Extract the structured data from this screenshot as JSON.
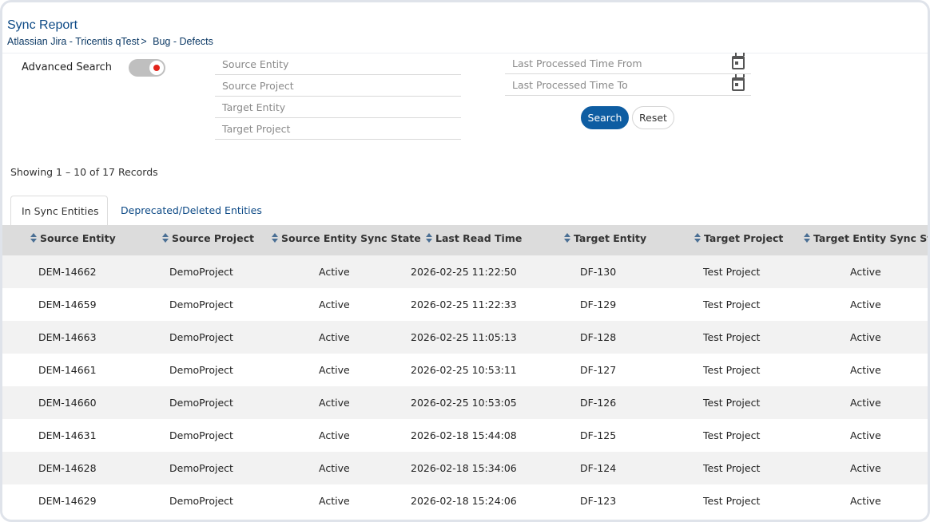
{
  "header": {
    "title": "Sync Report",
    "breadcrumb": [
      "Atlassian Jira - Tricentis qTest",
      "Bug - Defects"
    ],
    "breadcrumb_separator": ">"
  },
  "search": {
    "advanced_label": "Advanced Search",
    "advanced_enabled": true,
    "fields": {
      "source_entity": "Source Entity",
      "source_project": "Source Project",
      "target_entity": "Target Entity",
      "target_project": "Target Project",
      "last_processed_from": "Last Processed Time From",
      "last_processed_to": "Last Processed Time To"
    },
    "search_label": "Search",
    "reset_label": "Reset"
  },
  "records_text": "Showing 1 – 10 of 17 Records",
  "tabs": [
    {
      "label": "In Sync Entities",
      "active": true
    },
    {
      "label": "Deprecated/Deleted Entities",
      "active": false
    }
  ],
  "table": {
    "columns": [
      "Source Entity",
      "Source Project",
      "Source Entity Sync State",
      "Last Read Time",
      "Target Entity",
      "Target Project",
      "Target Entity Sync State"
    ],
    "rows": [
      [
        "DEM-14662",
        "DemoProject",
        "Active",
        "2026-02-25 11:22:50",
        "DF-130",
        "Test Project",
        "Active"
      ],
      [
        "DEM-14659",
        "DemoProject",
        "Active",
        "2026-02-25 11:22:33",
        "DF-129",
        "Test Project",
        "Active"
      ],
      [
        "DEM-14663",
        "DemoProject",
        "Active",
        "2026-02-25 11:05:13",
        "DF-128",
        "Test Project",
        "Active"
      ],
      [
        "DEM-14661",
        "DemoProject",
        "Active",
        "2026-02-25 10:53:11",
        "DF-127",
        "Test Project",
        "Active"
      ],
      [
        "DEM-14660",
        "DemoProject",
        "Active",
        "2026-02-25 10:53:05",
        "DF-126",
        "Test Project",
        "Active"
      ],
      [
        "DEM-14631",
        "DemoProject",
        "Active",
        "2026-02-18 15:44:08",
        "DF-125",
        "Test Project",
        "Active"
      ],
      [
        "DEM-14628",
        "DemoProject",
        "Active",
        "2026-02-18 15:34:06",
        "DF-124",
        "Test Project",
        "Active"
      ],
      [
        "DEM-14629",
        "DemoProject",
        "Active",
        "2026-02-18 15:24:06",
        "DF-123",
        "Test Project",
        "Active"
      ]
    ]
  },
  "colors": {
    "brand": "#0d4a86",
    "primary_button": "#0e5da2",
    "toggle_dot": "#e2231a",
    "table_header_bg": "#dcdcdc",
    "row_alt_bg": "#f2f2f2"
  }
}
